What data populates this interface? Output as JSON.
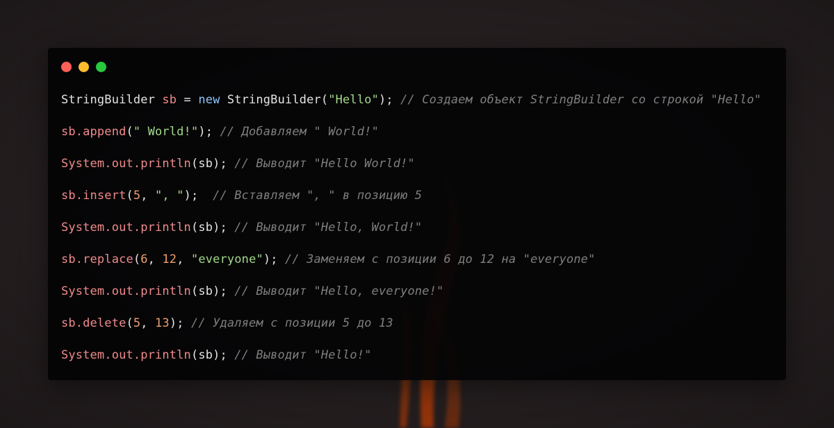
{
  "colors": {
    "background": "#2a2425",
    "window": "#040405",
    "dot_red": "#ff5f56",
    "dot_yellow": "#ffbd2e",
    "dot_green": "#27c93f",
    "variable": "#f08b8b",
    "number": "#f0a070",
    "keyword": "#8fc6ff",
    "string": "#a3d88a",
    "comment": "#7f7f7f",
    "plain": "#e4e4e4"
  },
  "code_lines": [
    {
      "tokens": [
        {
          "t": "pl",
          "text": "StringBuilder "
        },
        {
          "t": "v",
          "text": "sb"
        },
        {
          "t": "pl",
          "text": " = "
        },
        {
          "t": "k",
          "text": "new"
        },
        {
          "t": "pl",
          "text": " StringBuilder("
        },
        {
          "t": "s",
          "text": "\"Hello\""
        },
        {
          "t": "pl",
          "text": "); "
        },
        {
          "t": "c",
          "text": "// Создаем объект StringBuilder со строкой \"Hello\""
        }
      ]
    },
    {
      "tokens": [
        {
          "t": "v",
          "text": "sb.append"
        },
        {
          "t": "pl",
          "text": "("
        },
        {
          "t": "s",
          "text": "\" World!\""
        },
        {
          "t": "pl",
          "text": "); "
        },
        {
          "t": "c",
          "text": "// Добавляем \" World!\""
        }
      ]
    },
    {
      "tokens": [
        {
          "t": "v",
          "text": "System.out.println"
        },
        {
          "t": "pl",
          "text": "(sb); "
        },
        {
          "t": "c",
          "text": "// Выводит \"Hello World!\""
        }
      ]
    },
    {
      "tokens": [
        {
          "t": "v",
          "text": "sb.insert"
        },
        {
          "t": "pl",
          "text": "("
        },
        {
          "t": "n",
          "text": "5"
        },
        {
          "t": "pl",
          "text": ", "
        },
        {
          "t": "s",
          "text": "\", \""
        },
        {
          "t": "pl",
          "text": ");  "
        },
        {
          "t": "c",
          "text": "// Вставляем \", \" в позицию 5"
        }
      ]
    },
    {
      "tokens": [
        {
          "t": "v",
          "text": "System.out.println"
        },
        {
          "t": "pl",
          "text": "(sb); "
        },
        {
          "t": "c",
          "text": "// Выводит \"Hello, World!\""
        }
      ]
    },
    {
      "tokens": [
        {
          "t": "v",
          "text": "sb.replace"
        },
        {
          "t": "pl",
          "text": "("
        },
        {
          "t": "n",
          "text": "6"
        },
        {
          "t": "pl",
          "text": ", "
        },
        {
          "t": "n",
          "text": "12"
        },
        {
          "t": "pl",
          "text": ", "
        },
        {
          "t": "s",
          "text": "\"everyone\""
        },
        {
          "t": "pl",
          "text": "); "
        },
        {
          "t": "c",
          "text": "// Заменяем с позиции 6 до 12 на \"everyone\""
        }
      ]
    },
    {
      "tokens": [
        {
          "t": "v",
          "text": "System.out.println"
        },
        {
          "t": "pl",
          "text": "(sb); "
        },
        {
          "t": "c",
          "text": "// Выводит \"Hello, everyone!\""
        }
      ]
    },
    {
      "tokens": [
        {
          "t": "v",
          "text": "sb.delete"
        },
        {
          "t": "pl",
          "text": "("
        },
        {
          "t": "n",
          "text": "5"
        },
        {
          "t": "pl",
          "text": ", "
        },
        {
          "t": "n",
          "text": "13"
        },
        {
          "t": "pl",
          "text": "); "
        },
        {
          "t": "c",
          "text": "// Удаляем с позиции 5 до 13"
        }
      ]
    },
    {
      "tokens": [
        {
          "t": "v",
          "text": "System.out.println"
        },
        {
          "t": "pl",
          "text": "(sb); "
        },
        {
          "t": "c",
          "text": "// Выводит \"Hello!\""
        }
      ]
    }
  ]
}
